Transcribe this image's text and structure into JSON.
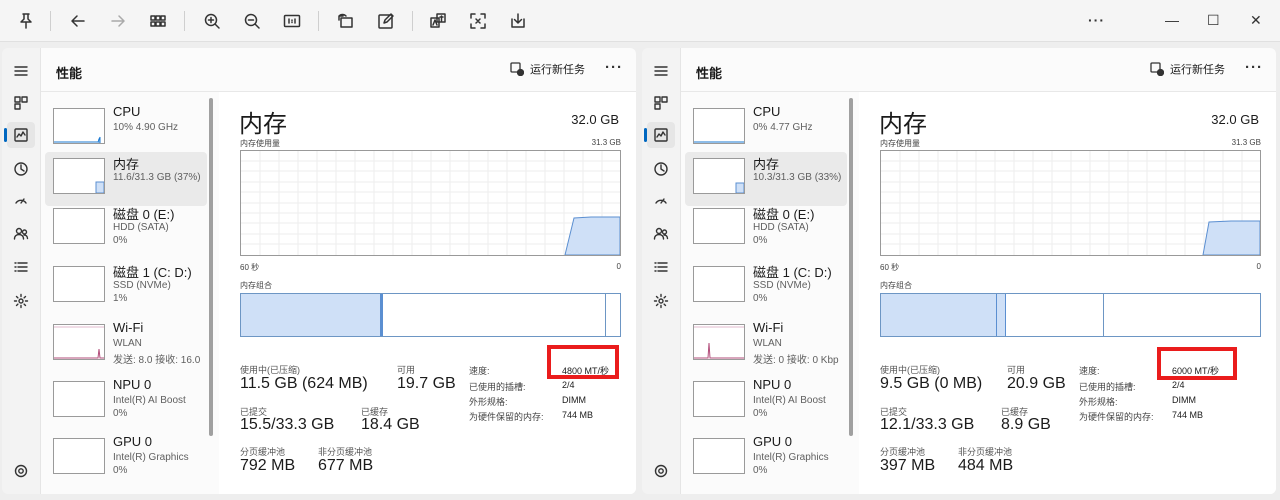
{
  "toolbar": {
    "icons": [
      "pin-icon",
      "back-arrow-icon",
      "forward-arrow-icon",
      "grid-icon",
      "zoom-in-icon",
      "zoom-out-icon",
      "actual-size-icon",
      "rotate-icon",
      "edit-icon",
      "translate-icon",
      "scan-icon",
      "save-icon"
    ],
    "more": "···",
    "minimize": "—",
    "restore": "☐",
    "close": "✕"
  },
  "panels": [
    {
      "page_title": "性能",
      "run_new_task": "运行新任务",
      "more": "···",
      "devices": [
        {
          "name": "CPU",
          "sub1": "10% 4.90 GHz",
          "sub2": ""
        },
        {
          "name": "内存",
          "sub1": "11.6/31.3 GB (37%)",
          "sub2": ""
        },
        {
          "name": "磁盘 0 (E:)",
          "sub1": "HDD (SATA)",
          "sub2": "0%"
        },
        {
          "name": "磁盘 1 (C: D:)",
          "sub1": "SSD (NVMe)",
          "sub2": "1%"
        },
        {
          "name": "Wi-Fi",
          "sub1": "WLAN",
          "sub2": "发送: 8.0 接收: 16.0"
        },
        {
          "name": "NPU 0",
          "sub1": "Intel(R) AI Boost",
          "sub2": "0%"
        },
        {
          "name": "GPU 0",
          "sub1": "Intel(R) Graphics",
          "sub2": "0%"
        }
      ],
      "detail": {
        "title": "内存",
        "total": "32.0 GB",
        "usage_label": "内存使用量",
        "usage_max": "31.3 GB",
        "time_left": "60 秒",
        "time_right": "0",
        "composition_label": "内存组合",
        "in_use_label": "使用中(已压缩)",
        "in_use_value": "11.5 GB (624 MB)",
        "available_label": "可用",
        "available_value": "19.7 GB",
        "committed_label": "已提交",
        "committed_value": "15.5/33.3 GB",
        "cached_label": "已缓存",
        "cached_value": "18.4 GB",
        "paged_label": "分页缓冲池",
        "paged_value": "792 MB",
        "nonpaged_label": "非分页缓冲池",
        "nonpaged_value": "677 MB",
        "speed_label": "速度:",
        "speed_value": "4800 MT/秒",
        "slots_label": "已使用的插槽:",
        "slots_value": "2/4",
        "form_label": "外形规格:",
        "form_value": "DIMM",
        "reserved_label": "为硬件保留的内存:",
        "reserved_value": "744 MB"
      }
    },
    {
      "page_title": "性能",
      "run_new_task": "运行新任务",
      "more": "···",
      "devices": [
        {
          "name": "CPU",
          "sub1": "0% 4.77 GHz",
          "sub2": ""
        },
        {
          "name": "内存",
          "sub1": "10.3/31.3 GB (33%)",
          "sub2": ""
        },
        {
          "name": "磁盘 0 (E:)",
          "sub1": "HDD (SATA)",
          "sub2": "0%"
        },
        {
          "name": "磁盘 1 (C: D:)",
          "sub1": "SSD (NVMe)",
          "sub2": "0%"
        },
        {
          "name": "Wi-Fi",
          "sub1": "WLAN",
          "sub2": "发送: 0 接收: 0 Kbp"
        },
        {
          "name": "NPU 0",
          "sub1": "Intel(R) AI Boost",
          "sub2": "0%"
        },
        {
          "name": "GPU 0",
          "sub1": "Intel(R) Graphics",
          "sub2": "0%"
        }
      ],
      "detail": {
        "title": "内存",
        "total": "32.0 GB",
        "usage_label": "内存使用量",
        "usage_max": "31.3 GB",
        "time_left": "60 秒",
        "time_right": "0",
        "composition_label": "内存组合",
        "in_use_label": "使用中(已压缩)",
        "in_use_value": "9.5 GB (0 MB)",
        "available_label": "可用",
        "available_value": "20.9 GB",
        "committed_label": "已提交",
        "committed_value": "12.1/33.3 GB",
        "cached_label": "已缓存",
        "cached_value": "8.9 GB",
        "paged_label": "分页缓冲池",
        "paged_value": "397 MB",
        "nonpaged_label": "非分页缓冲池",
        "nonpaged_value": "484 MB",
        "speed_label": "速度:",
        "speed_value": "6000 MT/秒",
        "slots_label": "已使用的插槽:",
        "slots_value": "2/4",
        "form_label": "外形规格:",
        "form_value": "DIMM",
        "reserved_label": "为硬件保留的内存:",
        "reserved_value": "744 MB"
      }
    }
  ],
  "colors": {
    "memory_fill": "#cfe0f7",
    "memory_stroke": "#5b8fd1",
    "wifi_stroke": "#b24d7a",
    "highlight": "#ea1c1c",
    "accent": "#0067c0"
  }
}
